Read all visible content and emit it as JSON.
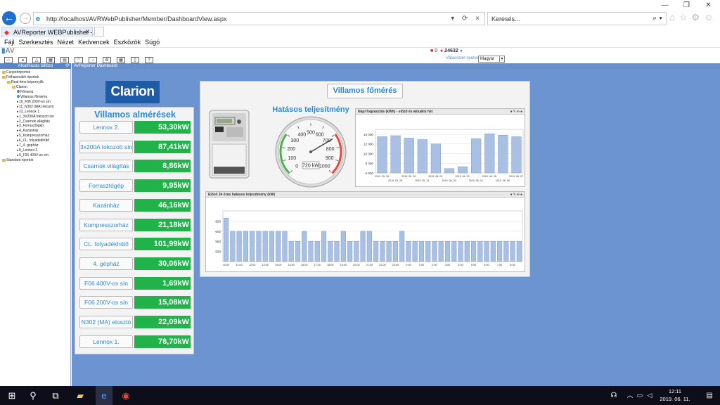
{
  "browser": {
    "url": "http://localhost/AVRWebPublisher/Member/DashboardView.aspx",
    "search_placeholder": "Keresés...",
    "tab_title": "AVReporter WEBPublisher -...",
    "menu": [
      "Fájl",
      "Szerkesztés",
      "Nézet",
      "Kedvencek",
      "Eszközök",
      "Súgó"
    ]
  },
  "app": {
    "logo": "AV",
    "status_count_red": "0",
    "status_count": "24632",
    "language_label": "Válasszon nyelvet:",
    "language_value": "Magyar"
  },
  "sidebar": {
    "title": "Alkalmazás tallózó",
    "tree": [
      "Csoportriportok",
      "Felhasználói riportok",
      "Real-time képernyők",
      "Clarion",
      "Főmenü",
      "Villamos főmérés",
      "10_F06 200V-os sín",
      "11_N302 (MA) elosztó",
      "12_Lennox 1.",
      "1_3X200A tokozott sín",
      "2_Csarnok világítás",
      "3_Forrasztógép",
      "4_Kazánház",
      "5_Kompresszorház",
      "6_CL. folyadékhűtő",
      "7_4. gépház",
      "8_Lennox 2.",
      "9_F06 400V-os sín",
      "Standard riportok"
    ]
  },
  "content_header": "AVReporter Dashboard",
  "brand": "Clarion",
  "submeters": {
    "title": "Villamos almérések",
    "items": [
      {
        "label": "Lennox 2.",
        "value": "53,30kW"
      },
      {
        "label": "3x200A tokozott sín",
        "value": "87,41kW"
      },
      {
        "label": "Csarnok világítás",
        "value": "8,86kW"
      },
      {
        "label": "Forrasztógép",
        "value": "9,95kW"
      },
      {
        "label": "Kazánház",
        "value": "46,16kW"
      },
      {
        "label": "Kompresszorház",
        "value": "21,18kW"
      },
      {
        "label": "CL. folyadékhűtő",
        "value": "101,99kW"
      },
      {
        "label": "4. gépház",
        "value": "30,06kW"
      },
      {
        "label": "F06 400V-os sín",
        "value": "1,69kW"
      },
      {
        "label": "F06 200V-os sín",
        "value": "15,08kW"
      },
      {
        "label": "N302 (MA) elosztó",
        "value": "22,09kW"
      },
      {
        "label": "Lennox 1.",
        "value": "78,70kW"
      }
    ]
  },
  "main_meter": {
    "title": "Villamos főmérés",
    "gauge_title": "Hatásos teljesítmény",
    "gauge_value": 720,
    "gauge_unit_label": "720 kW",
    "gauge_ticks": [
      "0",
      "100",
      "200",
      "300",
      "400",
      "500",
      "600",
      "700",
      "800",
      "900",
      "1000"
    ]
  },
  "chart_data": [
    {
      "type": "bar",
      "title": "Napi fogyasztás (kWh) - előző és aktuális hét",
      "categories": [
        "2019. 05. 28.",
        "2019. 05. 29.",
        "2019. 05. 30.",
        "2019. 05. 31.",
        "2019. 06. 01.",
        "2019. 06. 02.",
        "2019. 06. 03.",
        "2019. 06. 04.",
        "2019. 06. 05.",
        "2019. 06. 06.",
        "2019. 06. 07."
      ],
      "x_tick_labels": [
        "2019. 05. 28.",
        "2019. 05. 29.",
        "2019. 05. 30.",
        "2019. 05. 31.",
        "2019. 06. 01.",
        "2019. 06. 02.",
        "2019. 06. 03.",
        "2019. 06. 04.",
        "2019. 06. 05.",
        "2019. 06. 06.",
        "2019. 06. 07."
      ],
      "values": [
        13500,
        13700,
        13200,
        12900,
        12000,
        6900,
        7300,
        13100,
        14100,
        13800,
        13500
      ],
      "ylim": [
        6000,
        15000
      ],
      "yticks": [
        "6 000",
        "8 000",
        "10 000",
        "12 000",
        "14 000"
      ],
      "grid": true,
      "color": "#a9c0e3"
    },
    {
      "type": "bar",
      "title": "Előző 24 órás hatásos teljesítmény (kW)",
      "categories": [
        "10:00",
        "10:30",
        "11:00",
        "11:30",
        "12:00",
        "12:30",
        "13:00",
        "13:30",
        "14:00",
        "14:30",
        "15:00",
        "15:30",
        "16:00",
        "16:30",
        "17:00",
        "17:30",
        "18:00",
        "18:30",
        "19:00",
        "19:30",
        "20:00",
        "20:30",
        "21:00",
        "21:30",
        "22:00",
        "22:30",
        "23:00",
        "23:30",
        "0:00",
        "0:30",
        "1:00",
        "1:30",
        "2:00",
        "2:30",
        "3:00",
        "3:30",
        "4:00",
        "4:30",
        "5:00",
        "5:30",
        "6:00",
        "6:30",
        "7:00",
        "7:30",
        "8:00",
        "8:30"
      ],
      "x_tick_labels": [
        "10:00",
        "11:00",
        "12:00",
        "13:00",
        "14:00",
        "15:00",
        "16:00",
        "17:00",
        "18:00",
        "19:00",
        "20:00",
        "21:00",
        "22:00",
        "23:00",
        "0:00",
        "1:00",
        "2:00",
        "3:00",
        "4:00",
        "5:00",
        "6:00",
        "7:00",
        "8:00"
      ],
      "values": [
        665,
        600,
        600,
        600,
        600,
        600,
        600,
        600,
        600,
        600,
        550,
        550,
        600,
        550,
        550,
        600,
        550,
        550,
        600,
        550,
        550,
        600,
        600,
        550,
        550,
        550,
        550,
        600,
        550,
        550,
        550,
        550,
        550,
        550,
        550,
        550,
        550,
        550,
        550,
        550,
        550,
        550,
        550,
        550,
        550,
        550
      ],
      "ylim": [
        450,
        700
      ],
      "yticks": [
        "500",
        "550",
        "600",
        "650"
      ],
      "grid": true,
      "color": "#a9c0e3"
    }
  ],
  "taskbar": {
    "time": "12:11",
    "date": "2019. 06. 11."
  }
}
